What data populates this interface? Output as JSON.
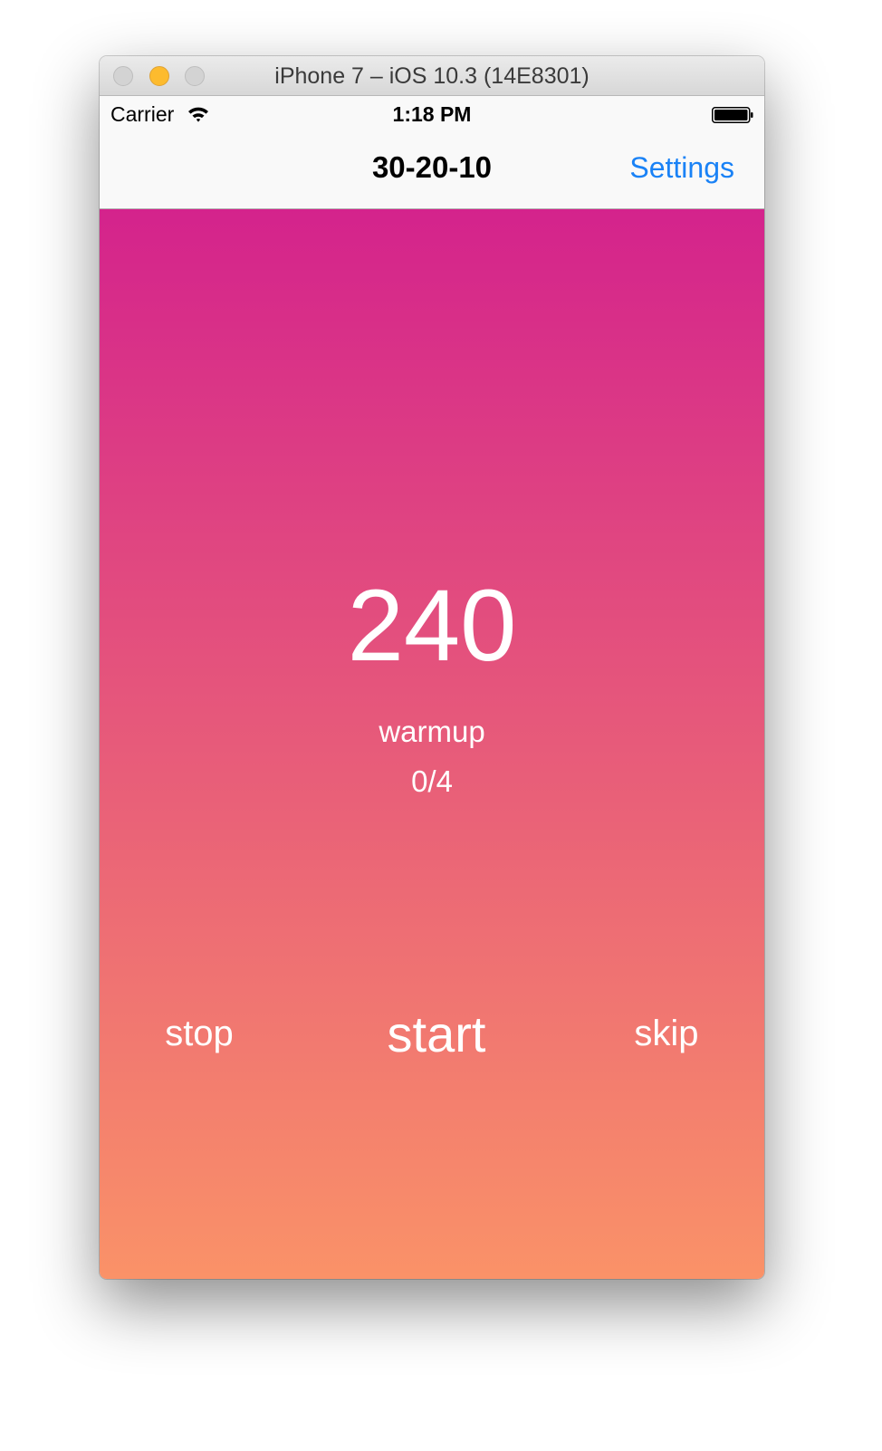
{
  "window": {
    "title": "iPhone 7 – iOS 10.3 (14E8301)"
  },
  "status_bar": {
    "carrier": "Carrier",
    "time": "1:18 PM",
    "signal_icon": "wifi-icon",
    "battery_icon": "battery-icon"
  },
  "nav_bar": {
    "title": "30-20-10",
    "settings_label": "Settings"
  },
  "timer": {
    "count": "240",
    "phase": "warmup",
    "progress": "0/4"
  },
  "controls": {
    "stop_label": "stop",
    "start_label": "start",
    "skip_label": "skip"
  },
  "colors": {
    "gradient_top": "#d4238c",
    "gradient_bottom": "#fa9268",
    "accent": "#1a82f6"
  }
}
